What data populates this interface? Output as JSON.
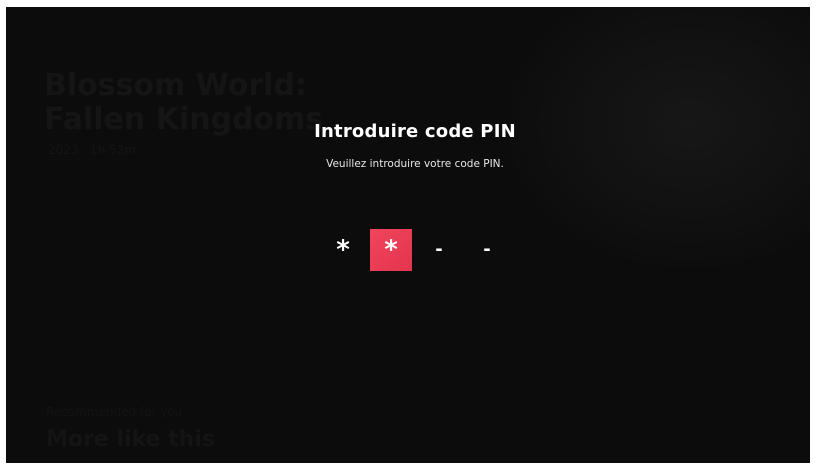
{
  "background": {
    "title": "Blossom World: Fallen Kingdoms",
    "meta": "2023 · 1h 52m",
    "row_label": "Recommended for you",
    "row_title": "More like this"
  },
  "dialog": {
    "title": "Introduire code PIN",
    "subtitle": "Veuillez introduire votre code PIN.",
    "pin": [
      {
        "glyph": "*",
        "state": "filled"
      },
      {
        "glyph": "*",
        "state": "active"
      },
      {
        "glyph": "-",
        "state": "empty"
      },
      {
        "glyph": "-",
        "state": "empty"
      }
    ]
  },
  "colors": {
    "backdrop": "#0c0c0c",
    "accent": "#e83a55",
    "text": "#ffffff"
  }
}
